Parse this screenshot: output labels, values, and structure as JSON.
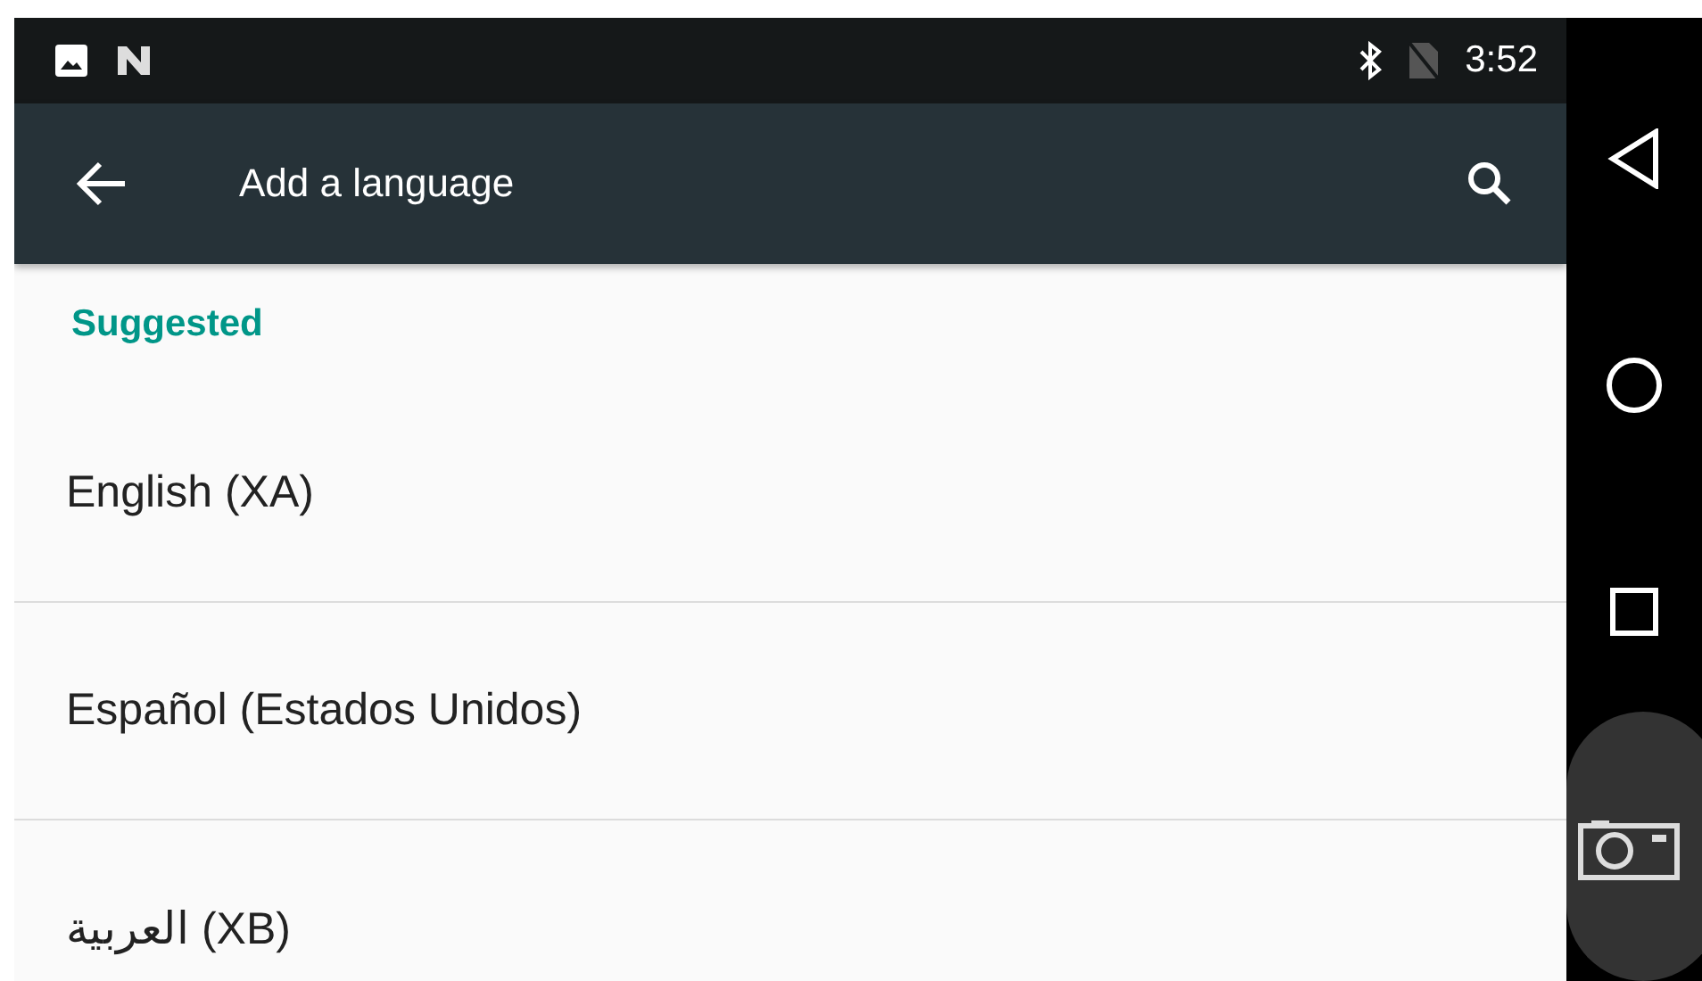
{
  "status_bar": {
    "time": "3:52"
  },
  "toolbar": {
    "title": "Add a language"
  },
  "section": {
    "header": "Suggested"
  },
  "languages": [
    {
      "label": "English (XA)"
    },
    {
      "label": "Español (Estados Unidos)"
    },
    {
      "label": "العربية (XB)"
    }
  ]
}
